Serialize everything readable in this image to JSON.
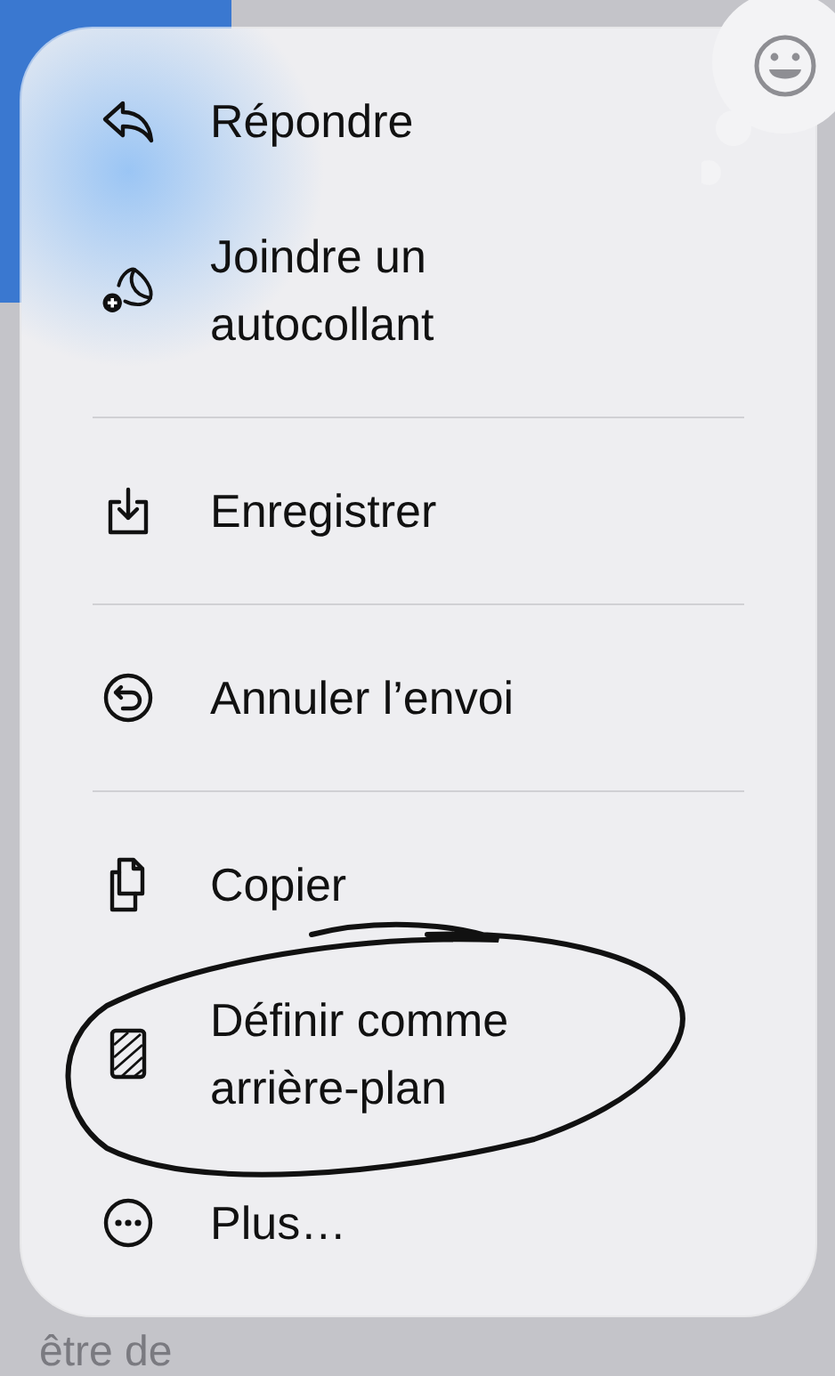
{
  "background": {
    "text": "être de"
  },
  "menu": {
    "groups": [
      {
        "items": [
          {
            "label": "Répondre",
            "kind": "reply"
          },
          {
            "label": "Joindre un autocollant",
            "kind": "sticker"
          }
        ]
      },
      {
        "items": [
          {
            "label": "Enregistrer",
            "kind": "save"
          }
        ]
      },
      {
        "items": [
          {
            "label": "Annuler l’envoi",
            "kind": "undo"
          }
        ]
      },
      {
        "items": [
          {
            "label": "Copier",
            "kind": "copy"
          },
          {
            "label": "Définir comme arrière-plan",
            "kind": "wallpaper"
          },
          {
            "label": "Plus…",
            "kind": "more"
          }
        ]
      }
    ]
  }
}
